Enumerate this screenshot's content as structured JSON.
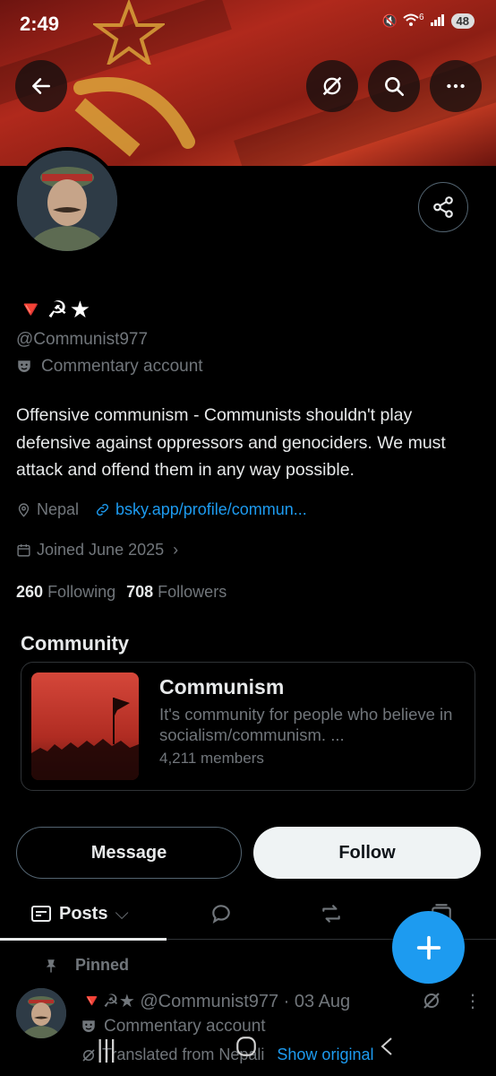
{
  "status": {
    "time": "2:49",
    "battery": "48",
    "signal_label": "6"
  },
  "profile": {
    "name_emojis": [
      "🔻",
      "☭",
      "★"
    ],
    "handle": "@Communist977",
    "account_label": "Commentary account",
    "bio": "Offensive communism - Communists shouldn't play defensive against oppressors and genociders. We must attack and offend them in any way possible.",
    "location": "Nepal",
    "link": "bsky.app/profile/commun...",
    "joined": "Joined June 2025",
    "following_count": "260",
    "following_label": "Following",
    "followers_count": "708",
    "followers_label": "Followers"
  },
  "community": {
    "section_title": "Community",
    "name": "Communism",
    "description": "It's community for people who believe in socialism/communism. ...",
    "members": "4,211 members"
  },
  "actions": {
    "message": "Message",
    "follow": "Follow"
  },
  "tabs": {
    "posts": "Posts"
  },
  "post": {
    "pinned_label": "Pinned",
    "header_text": "🔻☭★ @Communist977 · 03 Aug",
    "account_label": "Commentary account",
    "translated": "Translated from Nepali",
    "show_original": "Show original"
  },
  "colors": {
    "accent": "#1d9bf0",
    "background": "#000000",
    "banner": "#b0291c"
  }
}
